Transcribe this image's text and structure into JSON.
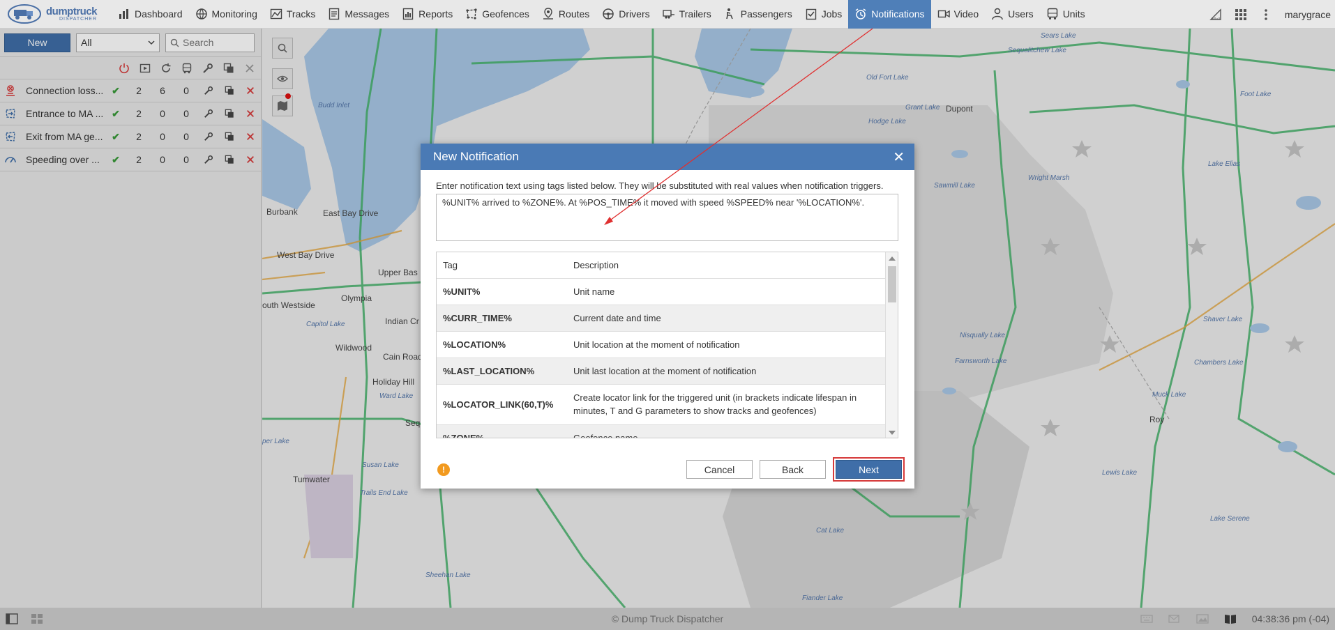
{
  "app": {
    "brand_line1": "dumptruck",
    "brand_line2": "DISPATCHER",
    "user": "marygrace"
  },
  "nav": [
    {
      "label": "Dashboard",
      "icon": "bar-chart-icon"
    },
    {
      "label": "Monitoring",
      "icon": "globe-icon"
    },
    {
      "label": "Tracks",
      "icon": "tracks-icon"
    },
    {
      "label": "Messages",
      "icon": "messages-icon"
    },
    {
      "label": "Reports",
      "icon": "reports-icon"
    },
    {
      "label": "Geofences",
      "icon": "geofence-icon"
    },
    {
      "label": "Routes",
      "icon": "route-pin-icon"
    },
    {
      "label": "Drivers",
      "icon": "steering-wheel-icon"
    },
    {
      "label": "Trailers",
      "icon": "trailer-icon"
    },
    {
      "label": "Passengers",
      "icon": "passenger-icon"
    },
    {
      "label": "Jobs",
      "icon": "jobs-check-icon"
    },
    {
      "label": "Notifications",
      "icon": "alarm-clock-icon",
      "active": true
    },
    {
      "label": "Video",
      "icon": "video-icon"
    },
    {
      "label": "Users",
      "icon": "user-icon"
    },
    {
      "label": "Units",
      "icon": "bus-icon"
    }
  ],
  "left_panel": {
    "new_label": "New",
    "filter_value": "All",
    "search_placeholder": "Search",
    "notifications": [
      {
        "name": "Connection loss...",
        "icon": "connection-loss-icon",
        "c1": "2",
        "c2": "6",
        "c3": "0"
      },
      {
        "name": "Entrance to MA ...",
        "icon": "geofence-entrance-icon",
        "c1": "2",
        "c2": "0",
        "c3": "0"
      },
      {
        "name": "Exit from MA ge...",
        "icon": "geofence-exit-icon",
        "c1": "2",
        "c2": "0",
        "c3": "0"
      },
      {
        "name": "Speeding over ...",
        "icon": "speedometer-icon",
        "c1": "2",
        "c2": "0",
        "c3": "0"
      }
    ]
  },
  "map": {
    "labels": {
      "budd_inlet": "Budd Inlet",
      "burbank": "Burbank",
      "east_bay": "East Bay Drive",
      "west_bay": "West Bay Drive",
      "upper_bas": "Upper Bas",
      "olympia": "Olympia",
      "south_westside": "outh Westside",
      "capitol_lake": "Capitol Lake",
      "indian_cr": "Indian Cr",
      "wildwood": "Wildwood",
      "cain_road": "Cain Road",
      "holiday_hill": "Holiday Hill",
      "ward_lake": "Ward Lake",
      "sequ": "Sequ",
      "upper_lake": "per Lake",
      "susan_lake": "Susan Lake",
      "tumwater": "Tumwater",
      "trails_end": "Trails End Lake",
      "sheehan": "Sheehan Lake",
      "cat_lake": "Cat Lake",
      "fiander": "Fiander Lake",
      "sears": "Sears Lake",
      "sequalitchew": "Sequalitchew Lake",
      "old_fort": "Old Fort Lake",
      "grant": "Grant Lake",
      "dupont": "Dupont",
      "hodge": "Hodge Lake",
      "foot": "Foot Lake",
      "lake_elias": "Lake Elias",
      "sawmill": "Sawmill Lake",
      "wright_marsh": "Wright Marsh",
      "nisqually": "Nisqually Lake",
      "farnsworth": "Farnsworth Lake",
      "shaver": "Shaver Lake",
      "chambers": "Chambers Lake",
      "muck": "Muck Lake",
      "roy": "Roy",
      "lewis": "Lewis Lake",
      "serene": "Lake Serene"
    }
  },
  "dialog": {
    "title": "New Notification",
    "instructions": "Enter notification text using tags listed below. They will be substituted with real values when notification triggers.",
    "text_value": "%UNIT% arrived to %ZONE%. At %POS_TIME% it moved with speed %SPEED% near '%LOCATION%'.",
    "table": {
      "headers": {
        "tag": "Tag",
        "description": "Description"
      },
      "rows": [
        {
          "tag": "%UNIT%",
          "description": "Unit name"
        },
        {
          "tag": "%CURR_TIME%",
          "description": "Current date and time"
        },
        {
          "tag": "%LOCATION%",
          "description": "Unit location at the moment of notification"
        },
        {
          "tag": "%LAST_LOCATION%",
          "description": "Unit last location at the moment of notification"
        },
        {
          "tag": "%LOCATOR_LINK(60,T)%",
          "description": "Create locator link for the triggered unit (in brackets indicate lifespan in minutes, T and G parameters to show tracks and geofences)"
        },
        {
          "tag": "%ZONE%",
          "description": "Geofence name"
        }
      ]
    },
    "buttons": {
      "cancel": "Cancel",
      "back": "Back",
      "next": "Next"
    },
    "warning_glyph": "!"
  },
  "status_bar": {
    "copyright": "© Dump Truck Dispatcher",
    "time": "04:38:36 pm (-04)"
  },
  "colors": {
    "accent": "#4a7ab5",
    "primary_button": "#3f6ea8",
    "highlight_border": "#d63a3a",
    "check_green": "#3a9a3a",
    "delete_red": "#d63a3a",
    "warning": "#f29a1f"
  }
}
